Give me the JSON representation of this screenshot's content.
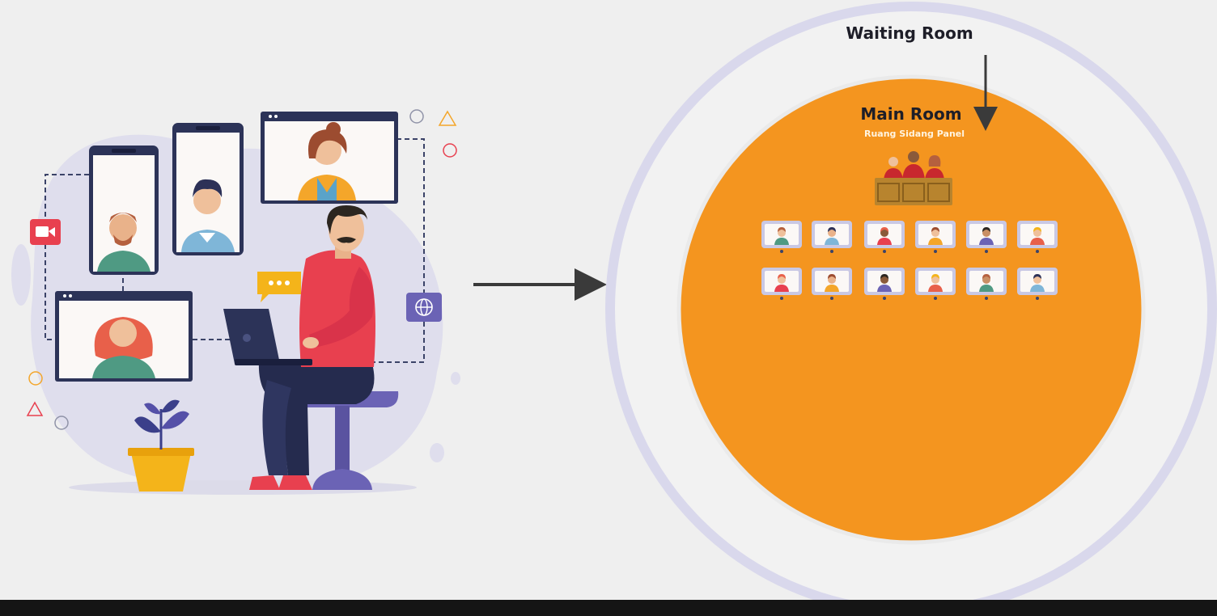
{
  "waiting_room": {
    "label": "Waiting Room"
  },
  "main_room": {
    "title": "Main Room",
    "subtitle": "Ruang Sidang Panel"
  },
  "colors": {
    "background": "#efefef",
    "outer_circle_fill": "#f2f2f2",
    "outer_circle_ring": "#d9d8ec",
    "main_circle": "#f4951f",
    "arrow": "#3a3a3a",
    "tile_frame": "#c9c8e4",
    "blob": "#dfdeed",
    "shirt_red": "#e8404f",
    "pants_navy": "#252b4e",
    "chair_purple": "#6b63b5",
    "pot_yellow": "#f4b41a",
    "bench_brown": "#b8842e"
  },
  "icons": [
    "video-camera-icon",
    "chat-bubble-icon",
    "globe-icon",
    "plant-icon",
    "laptop-icon"
  ],
  "participant_grid": {
    "rows": 2,
    "columns": 6
  }
}
